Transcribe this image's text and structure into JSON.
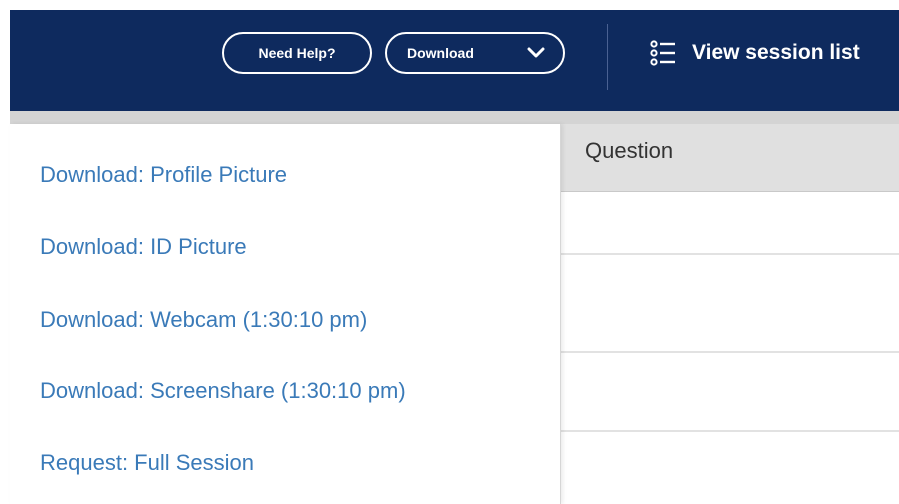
{
  "header": {
    "help_label": "Need Help?",
    "download_label": "Download",
    "session_list_label": "View session list"
  },
  "table": {
    "column_header": "Question"
  },
  "download_menu": {
    "items": [
      {
        "label": "Download: Profile Picture"
      },
      {
        "label": "Download: ID Picture"
      },
      {
        "label": "Download: Webcam (1:30:10 pm)"
      },
      {
        "label": "Download: Screenshare (1:30:10 pm)"
      },
      {
        "label": "Request: Full Session"
      }
    ]
  },
  "colors": {
    "topbar": "#0e2a5e",
    "link": "#3a7ab8",
    "table_header": "#e0e0e0"
  },
  "icons": {
    "download_chevron": "chevron-down-icon",
    "session_list": "list-icon"
  }
}
